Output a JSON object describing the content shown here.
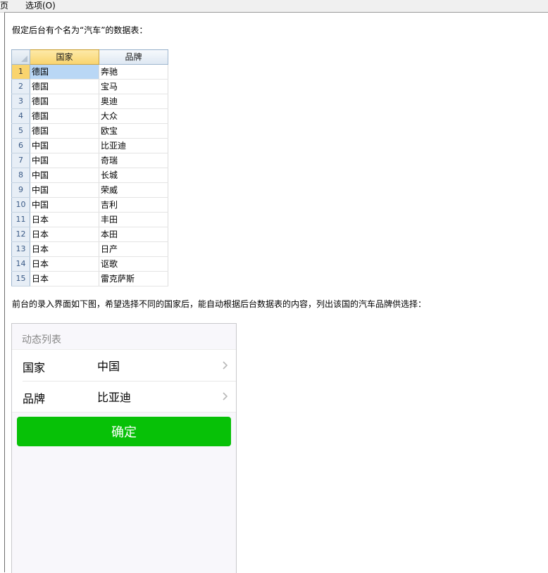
{
  "menu": {
    "items": [
      "页",
      "选项(O)"
    ]
  },
  "intro_text": "假定后台有个名为“汽车”的数据表：",
  "table": {
    "headers": [
      "国家",
      "品牌"
    ],
    "rows": [
      {
        "num": "1",
        "country": "德国",
        "brand": "奔驰"
      },
      {
        "num": "2",
        "country": "德国",
        "brand": "宝马"
      },
      {
        "num": "3",
        "country": "德国",
        "brand": "奥迪"
      },
      {
        "num": "4",
        "country": "德国",
        "brand": "大众"
      },
      {
        "num": "5",
        "country": "德国",
        "brand": "欧宝"
      },
      {
        "num": "6",
        "country": "中国",
        "brand": "比亚迪"
      },
      {
        "num": "7",
        "country": "中国",
        "brand": "奇瑞"
      },
      {
        "num": "8",
        "country": "中国",
        "brand": "长城"
      },
      {
        "num": "9",
        "country": "中国",
        "brand": "荣威"
      },
      {
        "num": "10",
        "country": "中国",
        "brand": "吉利"
      },
      {
        "num": "11",
        "country": "日本",
        "brand": "丰田"
      },
      {
        "num": "12",
        "country": "日本",
        "brand": "本田"
      },
      {
        "num": "13",
        "country": "日本",
        "brand": "日产"
      },
      {
        "num": "14",
        "country": "日本",
        "brand": "讴歌"
      },
      {
        "num": "15",
        "country": "日本",
        "brand": "雷克萨斯"
      }
    ]
  },
  "description_text": "前台的录入界面如下图，希望选择不同的国家后，能自动根据后台数据表的内容，列出该国的汽车品牌供选择：",
  "form": {
    "title": "动态列表",
    "fields": [
      {
        "label": "国家",
        "value": "中国",
        "icon": "chevron-right-icon"
      },
      {
        "label": "品牌",
        "value": "比亚迪",
        "icon": "chevron-right-icon"
      }
    ],
    "confirm_label": "确定"
  },
  "colors": {
    "confirm_button": "#07c107",
    "active_cell": "#b9d7f5",
    "selected_header": "#f9d46e"
  }
}
